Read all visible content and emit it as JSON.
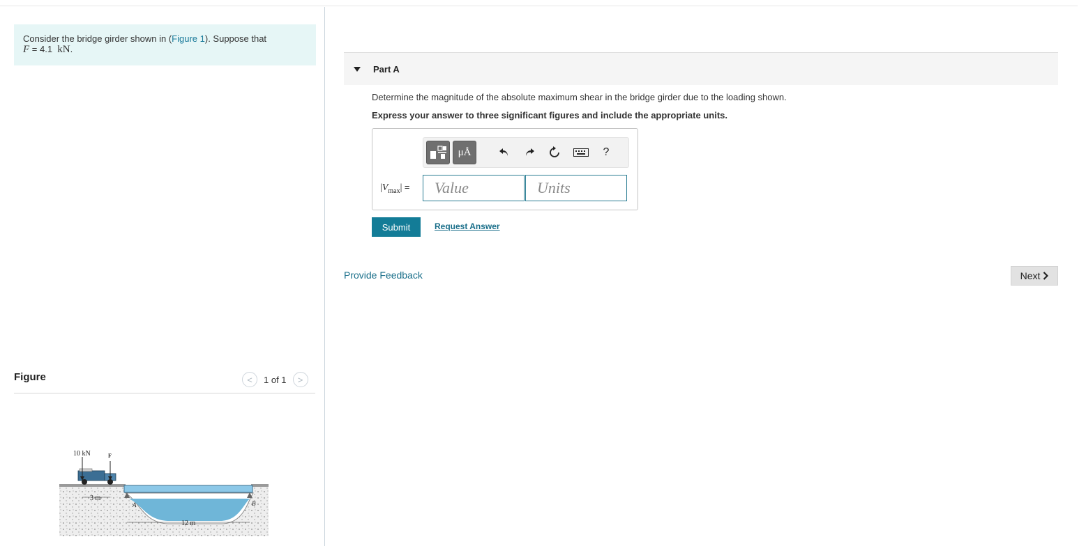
{
  "intro": {
    "text_before": "Consider the bridge girder shown in (",
    "figure_link": "Figure 1",
    "text_after": "). Suppose that",
    "force_symbol": "F",
    "force_eq": " = 4.1  ",
    "force_unit": "kN",
    "force_end": "."
  },
  "figure_panel": {
    "title": "Figure",
    "pager": "1 of 1",
    "prev_glyph": "<",
    "next_glyph": ">",
    "labels": {
      "load1": "10 kN",
      "load2": "F",
      "spacing": "3 m",
      "span": "12 m",
      "support_a": "A",
      "support_b": "B"
    }
  },
  "part_a": {
    "label": "Part A",
    "question": "Determine the magnitude of the absolute maximum shear in the bridge girder due to the loading shown.",
    "instruction": "Express your answer to three significant figures and include the appropriate units.",
    "toolbar": {
      "mu_button": "μÅ",
      "help": "?"
    },
    "variable": "V",
    "variable_sub": "max",
    "equals": "=",
    "value_placeholder": "Value",
    "units_placeholder": "Units",
    "submit": "Submit",
    "request_answer": "Request Answer"
  },
  "footer": {
    "feedback": "Provide Feedback",
    "next": "Next"
  }
}
